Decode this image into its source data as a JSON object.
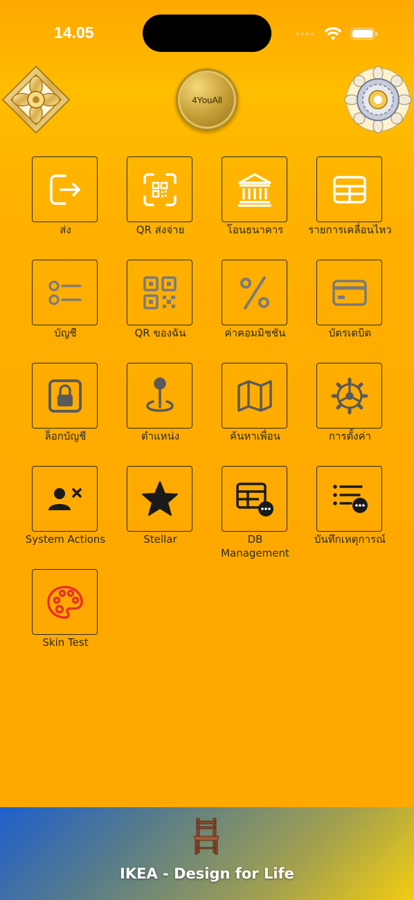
{
  "status_bar": {
    "time": "14.05"
  },
  "header": {
    "coin_label": "4YouAll"
  },
  "menu": [
    {
      "label": "ส่ง",
      "icon": "export-arrow-icon"
    },
    {
      "label": "QR ส่งจ่าย",
      "icon": "qr-scan-icon"
    },
    {
      "label": "โอนธนาคาร",
      "icon": "bank-icon"
    },
    {
      "label": "รายการเคลื่อนไหว",
      "icon": "table-icon"
    },
    {
      "label": "บัญชี",
      "icon": "list-icon"
    },
    {
      "label": "QR ของฉัน",
      "icon": "qr-code-icon"
    },
    {
      "label": "ค่าคอมมิชชัน",
      "icon": "percent-icon"
    },
    {
      "label": "บัตรเดบิต",
      "icon": "credit-card-icon"
    },
    {
      "label": "ล็อกบัญชี",
      "icon": "lock-icon"
    },
    {
      "label": "ตำแหน่ง",
      "icon": "location-pin-icon"
    },
    {
      "label": "ค้นหาเพื่อน",
      "icon": "map-icon"
    },
    {
      "label": "การตั้งค่า",
      "icon": "settings-gear-icon"
    },
    {
      "label": "System Actions",
      "icon": "remove-user-icon"
    },
    {
      "label": "Stellar",
      "icon": "star-icon"
    },
    {
      "label": "DB\nManagement",
      "icon": "database-table-icon"
    },
    {
      "label": "บันทึกเหตุการณ์",
      "icon": "event-log-icon"
    },
    {
      "label": "Skin Test",
      "icon": "palette-icon"
    }
  ],
  "banner": {
    "title": "IKEA - Design for Life",
    "icon": "chair-icon"
  },
  "colors": {
    "background": "#FFA800",
    "tile_border": "#2b2b2b",
    "icon_white": "#FFFFFF",
    "icon_gray": "#7a7a7a",
    "icon_dark": "#1a1a1a",
    "palette_red": "#E5322B",
    "banner_blue": "#1E5FCC",
    "banner_yellow": "#F2CC10"
  }
}
